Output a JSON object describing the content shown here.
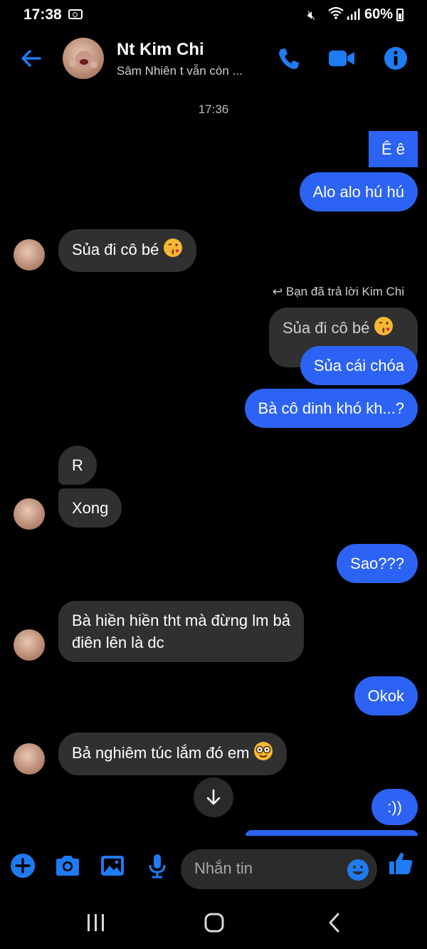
{
  "status_bar": {
    "time": "17:38",
    "battery": "60%"
  },
  "header": {
    "name": "Nt Kim Chi",
    "status": "Sâm Nhiên t vẫn còn  ..."
  },
  "conversation": {
    "timestamp": "17:36",
    "reply_note": "Bạn đã trả lời Kim Chi",
    "messages": [
      {
        "from": "me",
        "text": "Ê ê"
      },
      {
        "from": "me",
        "text": "Alo alo hú hú"
      },
      {
        "from": "them",
        "text": "Sủa đi cô bé"
      },
      {
        "from": "quote",
        "text": "Sủa đi cô bé"
      },
      {
        "from": "me",
        "text": "Sủa cái chóa"
      },
      {
        "from": "me",
        "text": "Bà cô dinh khó kh...?"
      },
      {
        "from": "them",
        "text": "R"
      },
      {
        "from": "them",
        "text": "Xong"
      },
      {
        "from": "me",
        "text": "Sao???"
      },
      {
        "from": "them",
        "text": "Bà hiền hiền tht mà đừng lm bả"
      },
      {
        "from": "them",
        "text": "điên lên là dc"
      },
      {
        "from": "me",
        "text": "Okok"
      },
      {
        "from": "them",
        "text": "Bả nghiêm túc lắm đó em"
      },
      {
        "from": "me",
        "text": ":))"
      }
    ]
  },
  "composer": {
    "placeholder": "Nhắn tin"
  },
  "colors": {
    "accent": "#2c63f4",
    "icon_blue": "#1f7bf2",
    "incoming_bubble": "#303030"
  },
  "icons": [
    "back-arrow-icon",
    "phone-icon",
    "video-icon",
    "info-icon",
    "plus-icon",
    "camera-icon",
    "image-icon",
    "microphone-icon",
    "emoji-icon",
    "like-icon",
    "arrow-down-icon"
  ]
}
